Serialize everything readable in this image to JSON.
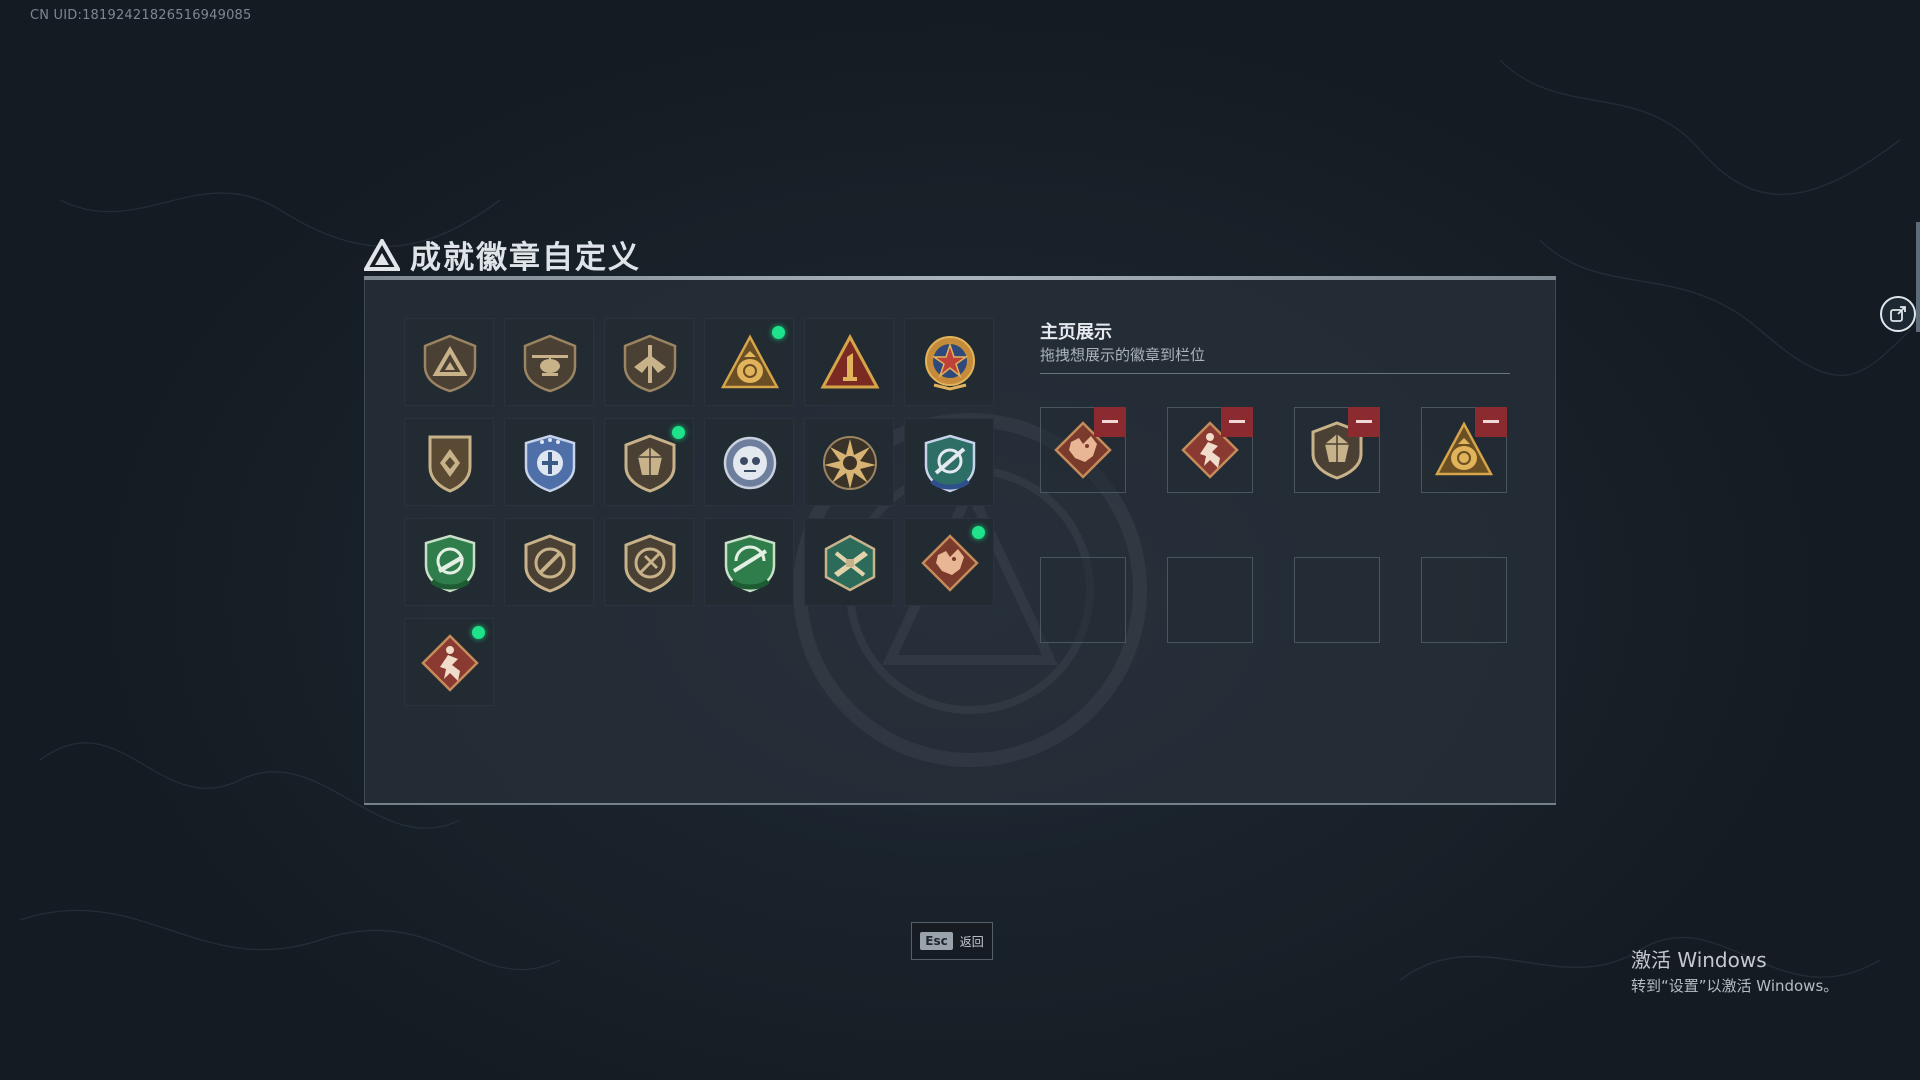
{
  "uid_text": "CN UID:1819242182651694908​5",
  "page": {
    "title": "成就徽章自定义"
  },
  "showcase": {
    "title": "主页展示",
    "subtitle": "拖拽想展示的徽章到栏位"
  },
  "badges": [
    {
      "icon": "delta-shield-badge-icon",
      "new": false
    },
    {
      "icon": "helicopter-badge-icon",
      "new": false
    },
    {
      "icon": "wings-badge-icon",
      "new": false
    },
    {
      "icon": "gold-bag-badge-icon",
      "new": true
    },
    {
      "icon": "rank-one-triangle-badge-icon",
      "new": false
    },
    {
      "icon": "star-medal-badge-icon",
      "new": false
    },
    {
      "icon": "chevron-shield-badge-icon",
      "new": false
    },
    {
      "icon": "police-shield-badge-icon",
      "new": false
    },
    {
      "icon": "gem-shield-badge-icon",
      "new": true
    },
    {
      "icon": "skull-emblem-badge-icon",
      "new": false
    },
    {
      "icon": "explosion-badge-icon",
      "new": false
    },
    {
      "icon": "crosshair-blue-shield-badge-icon",
      "new": false
    },
    {
      "icon": "rifle-green-shield-badge-icon",
      "new": false
    },
    {
      "icon": "no-bullet-badge-icon",
      "new": false
    },
    {
      "icon": "no-knife-badge-icon",
      "new": false
    },
    {
      "icon": "sniper-green-shield-badge-icon",
      "new": false
    },
    {
      "icon": "weapons-hexagon-badge-icon",
      "new": false
    },
    {
      "icon": "dragon-diamond-badge-icon",
      "new": true
    },
    {
      "icon": "runner-diamond-badge-icon",
      "new": true
    }
  ],
  "slots": [
    {
      "icon": "dragon-diamond-badge-icon",
      "filled": true
    },
    {
      "icon": "runner-diamond-badge-icon",
      "filled": true
    },
    {
      "icon": "gem-shield-badge-icon",
      "filled": true
    },
    {
      "icon": "gold-bag-badge-icon",
      "filled": true
    },
    {
      "icon": "",
      "filled": false
    },
    {
      "icon": "",
      "filled": false
    },
    {
      "icon": "",
      "filled": false
    },
    {
      "icon": "",
      "filled": false
    }
  ],
  "footer": {
    "esc_key": "Esc",
    "esc_label": "返回"
  },
  "windows_activation": {
    "line1": "激活 Windows",
    "line2": "转到“设置”以激活 Windows。"
  },
  "colors": {
    "new_dot": "#1ee38a",
    "remove": "#8b2b2f",
    "bronze": "#b8945a",
    "gold": "#d5a449",
    "green": "#2f7d4a",
    "blue": "#3a5a86",
    "red": "#8a3a30"
  }
}
